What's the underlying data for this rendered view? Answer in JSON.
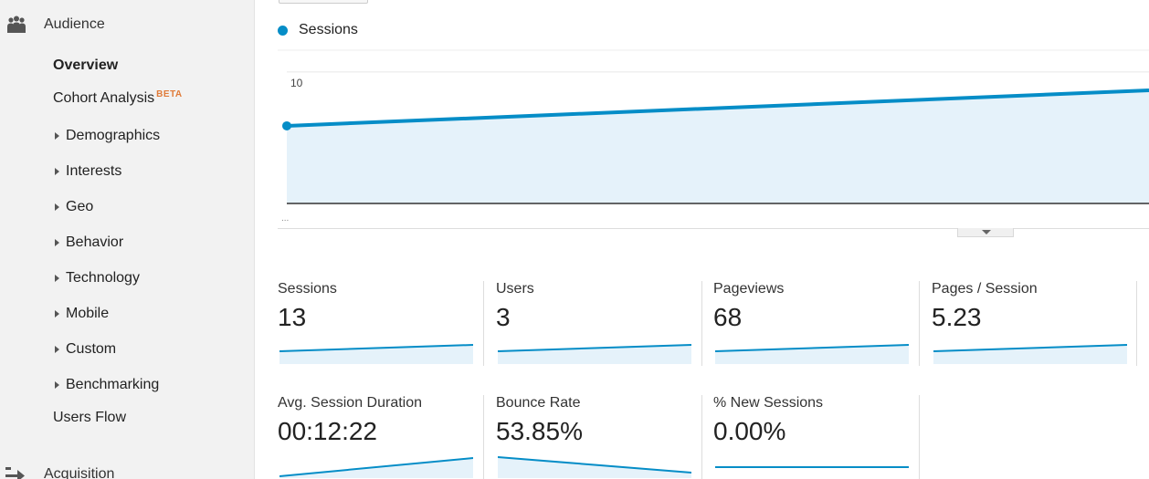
{
  "sidebar": {
    "audience": {
      "label": "Audience",
      "icon": "users-icon"
    },
    "items": [
      {
        "label": "Overview",
        "bold": true
      },
      {
        "label": "Cohort Analysis",
        "badge": "BETA"
      }
    ],
    "expandable": [
      "Demographics",
      "Interests",
      "Geo",
      "Behavior",
      "Technology",
      "Mobile",
      "Custom",
      "Benchmarking"
    ],
    "users_flow": "Users Flow",
    "acquisition": {
      "label": "Acquisition",
      "icon": "acquisition-arrow-icon"
    }
  },
  "legend": {
    "series_name": "Sessions",
    "color": "#058dc7"
  },
  "chart_data": {
    "type": "area",
    "series": [
      {
        "name": "Sessions",
        "values": [
          5.9,
          8.6
        ]
      }
    ],
    "ylim": [
      0,
      12
    ],
    "y_ticks": [
      "10",
      "5"
    ],
    "x_ticks": [
      "..."
    ],
    "color": "#058dc7",
    "fill": "#e5f2fa"
  },
  "metrics": [
    {
      "label": "Sessions",
      "value": "13",
      "trend": "up"
    },
    {
      "label": "Users",
      "value": "3",
      "trend": "up"
    },
    {
      "label": "Pageviews",
      "value": "68",
      "trend": "up"
    },
    {
      "label": "Pages / Session",
      "value": "5.23",
      "trend": "up"
    },
    {
      "label": "Avg. Session Duration",
      "value": "00:12:22",
      "trend": "up-steep"
    },
    {
      "label": "Bounce Rate",
      "value": "53.85%",
      "trend": "down"
    },
    {
      "label": "% New Sessions",
      "value": "0.00%",
      "trend": "flat"
    }
  ]
}
